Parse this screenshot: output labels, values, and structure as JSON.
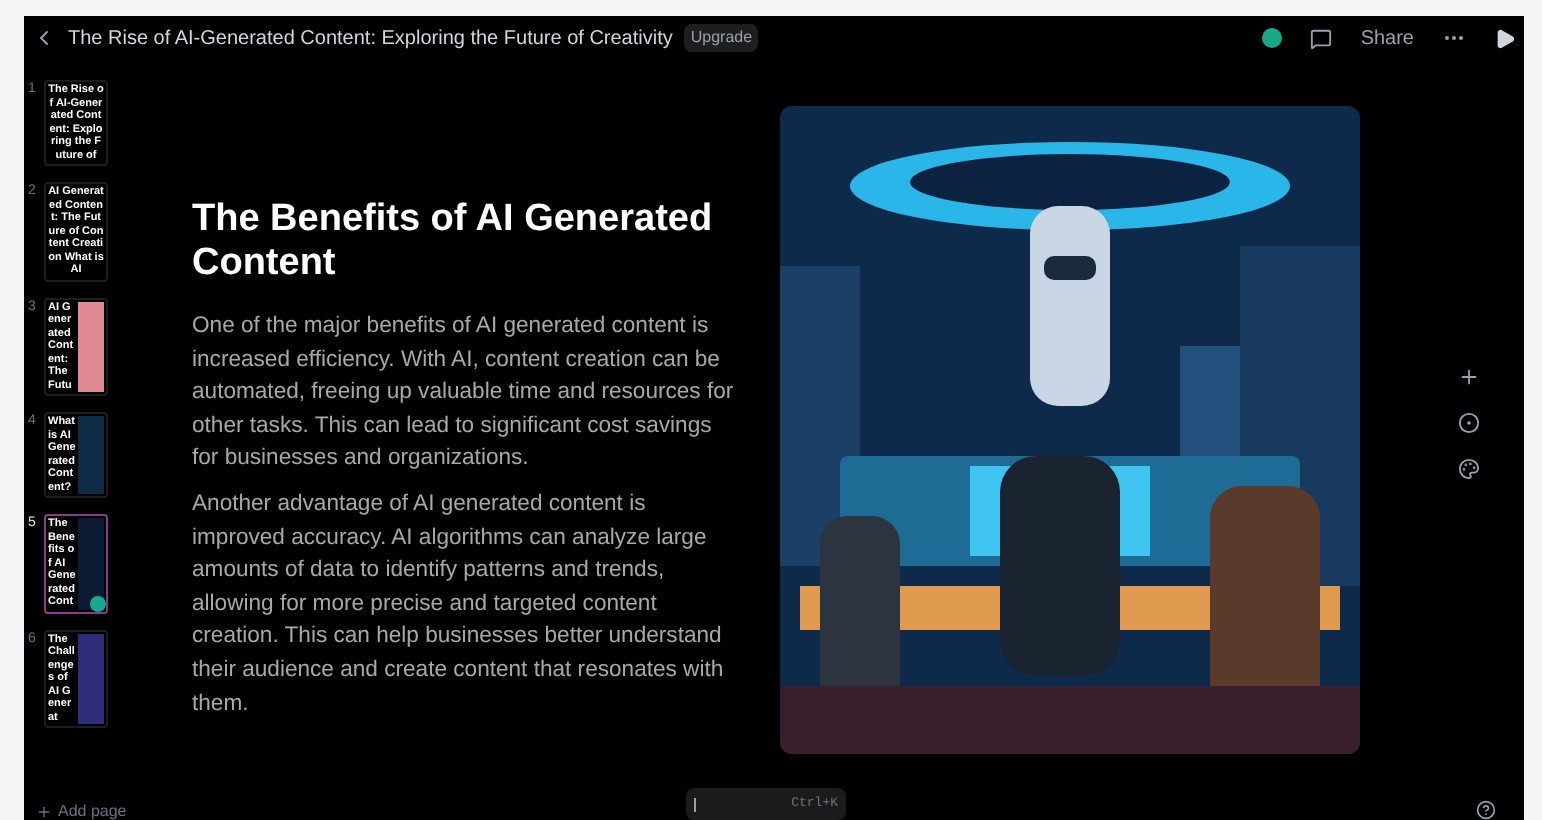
{
  "header": {
    "title": "The Rise of AI-Generated Content: Exploring the Future of Creativity",
    "badge": "Upgrade",
    "share": "Share"
  },
  "pages": [
    {
      "number": "1",
      "text": "The Rise of AI-Generated Content: Exploring the Future of",
      "selected": false,
      "kind": "text"
    },
    {
      "number": "2",
      "text": "AI Generated Content: The Future of Content Creation What is AI",
      "selected": false,
      "kind": "text"
    },
    {
      "number": "3",
      "text": "AI Generated Content: The Futu",
      "selected": false,
      "kind": "split",
      "color": "#e08a93"
    },
    {
      "number": "4",
      "text": "What is AI Generated Content?",
      "selected": false,
      "kind": "split",
      "color": "#0f2b45"
    },
    {
      "number": "5",
      "text": "The Benefits of AI Generated Cont",
      "selected": true,
      "kind": "split",
      "color": "#0c1a33"
    },
    {
      "number": "6",
      "text": "The Challenges of AI Generat",
      "selected": false,
      "kind": "split",
      "color": "#2e2e78"
    }
  ],
  "add_page": "Add page",
  "slide": {
    "heading": "The Benefits of AI Generated Content",
    "paragraphs": [
      "One of the major benefits of AI generated content is increased efficiency. With AI, content creation can be automated, freeing up valuable time and resources for other tasks. This can lead to significant cost savings for businesses and organizations.",
      "Another advantage of AI generated content is improved accuracy. AI algorithms can analyze large amounts of data to identify patterns and trends, allowing for more precise and targeted content creation. This can help businesses better understand their audience and create content that resonates with them."
    ]
  },
  "command": {
    "shortcut": "Ctrl+K"
  }
}
